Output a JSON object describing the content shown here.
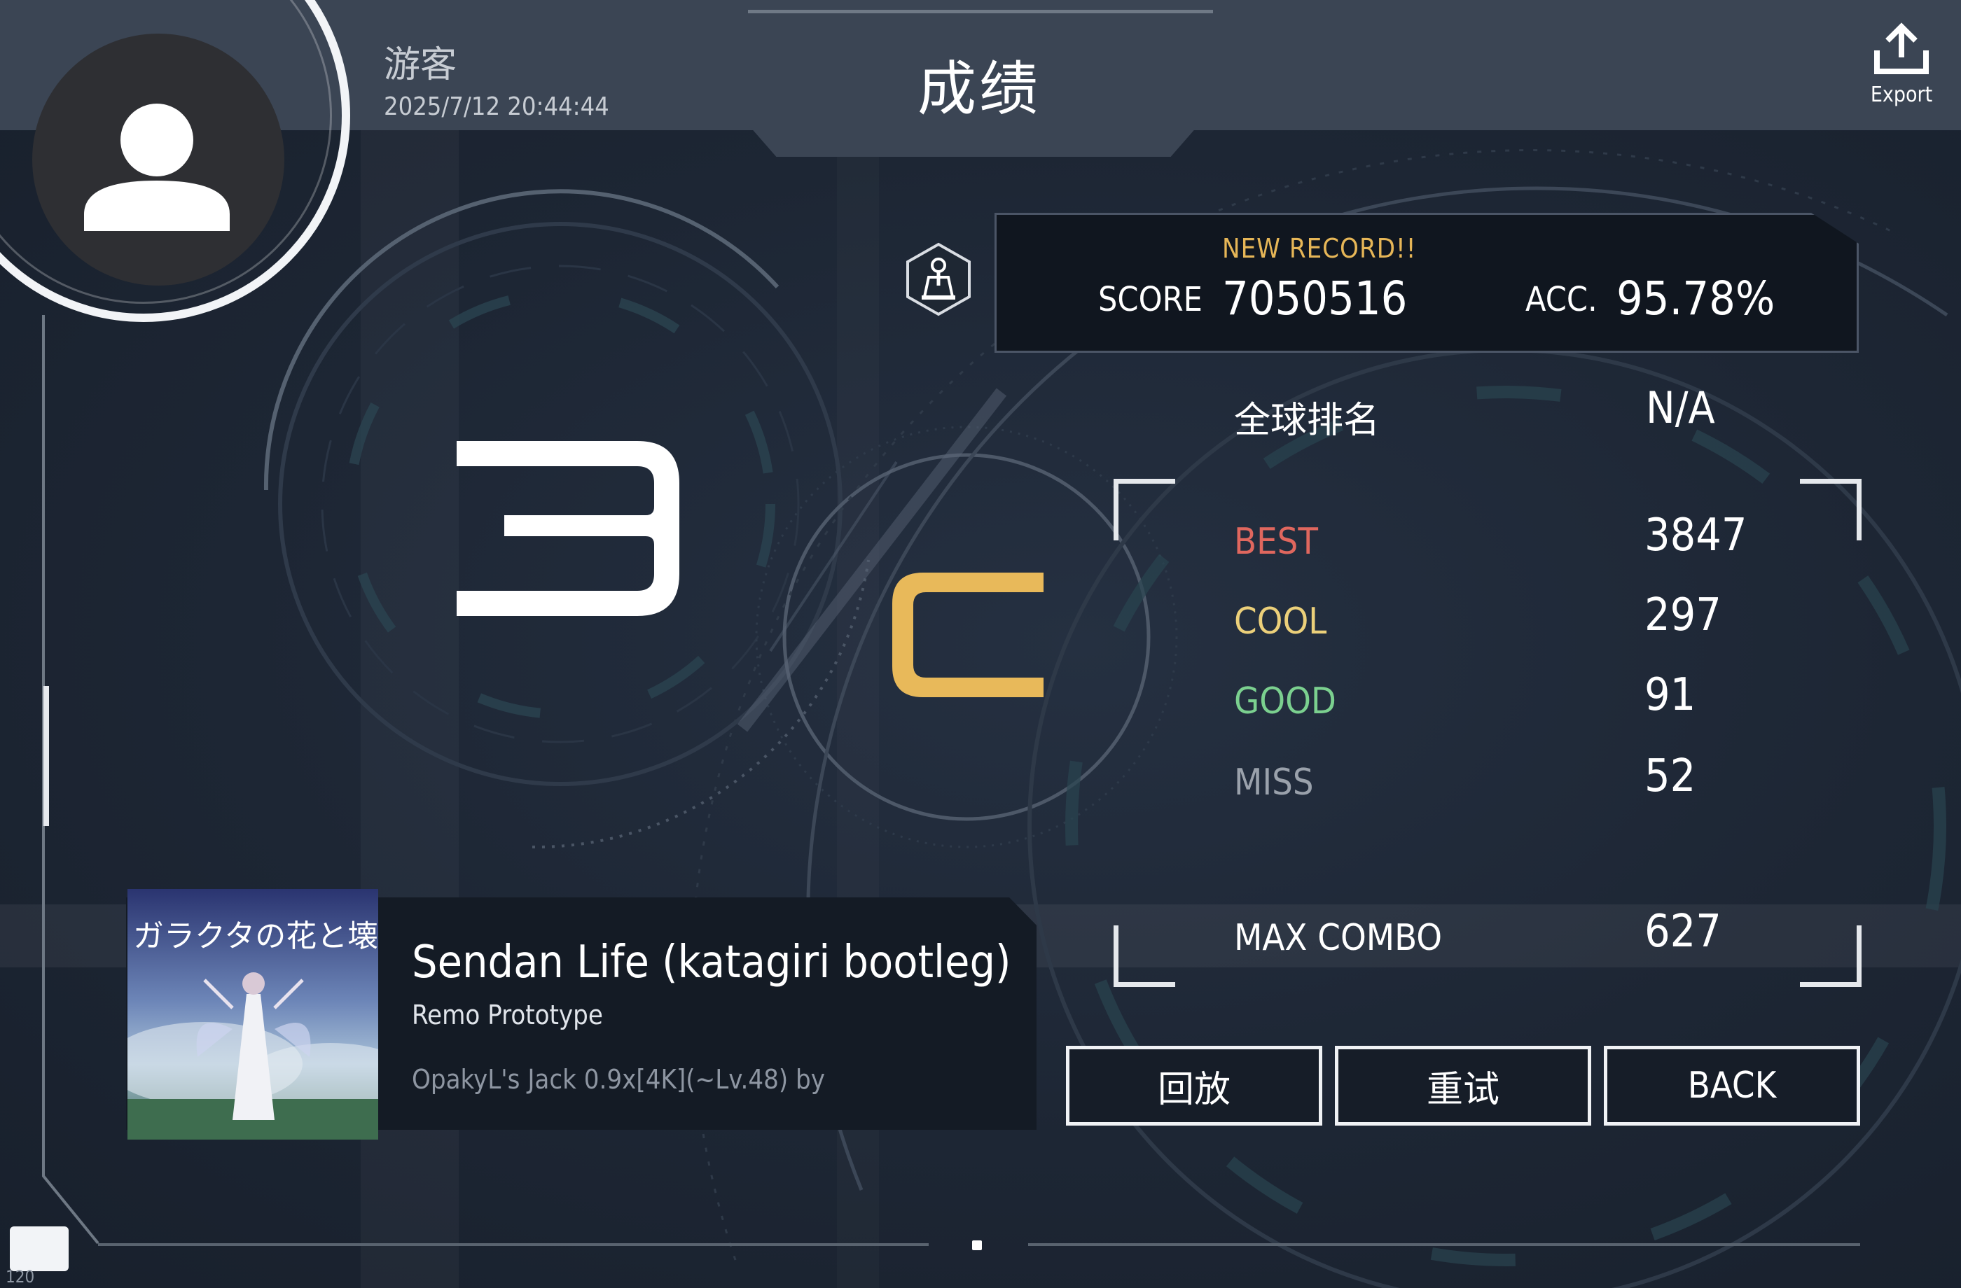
{
  "header": {
    "username": "游客",
    "datetime": "2025/7/12 20:44:44",
    "title": "成绩",
    "export_label": "Export"
  },
  "score_panel": {
    "new_record": "NEW RECORD!!",
    "score_label": "SCORE",
    "score_value": "7050516",
    "acc_label": "ACC.",
    "acc_value": "95.78%"
  },
  "grade": {
    "key_count_symbol": "3",
    "rank_letter": "C",
    "rank_color": "#e8b95a"
  },
  "stats": {
    "global_rank_label": "全球排名",
    "global_rank_value": "N/A",
    "judgements": [
      {
        "label": "BEST",
        "value": "3847",
        "color": "#e0675e"
      },
      {
        "label": "COOL",
        "value": "297",
        "color": "#ecd07a"
      },
      {
        "label": "GOOD",
        "value": "91",
        "color": "#7bd08f"
      },
      {
        "label": "MISS",
        "value": "52",
        "color": "#9aa1ab"
      }
    ],
    "max_combo_label": "MAX COMBO",
    "max_combo_value": "627"
  },
  "song": {
    "title": "Sendan Life (katagiri bootleg)",
    "artist": "Remo Prototype",
    "chart_info": "OpakyL's Jack 0.9x[4K](~Lv.48) by",
    "cover_text": "ガラクタの花と壊れた世界"
  },
  "buttons": {
    "replay": "回放",
    "retry": "重试",
    "back": "BACK"
  },
  "footer": {
    "corner_text": "120"
  }
}
